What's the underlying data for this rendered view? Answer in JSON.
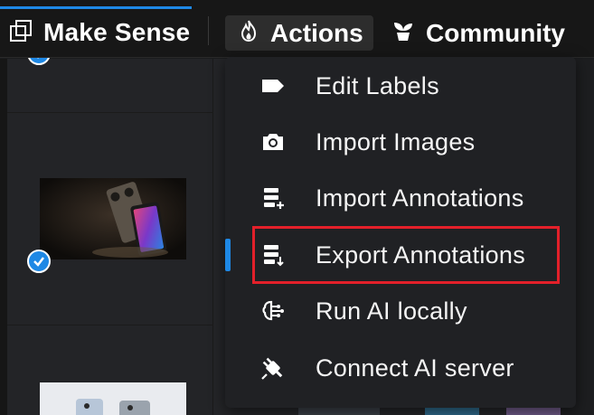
{
  "app": {
    "title": "Make Sense"
  },
  "nav": {
    "actions_label": "Actions",
    "community_label": "Community",
    "actions_icon": "flame-icon",
    "community_icon": "plant-icon",
    "brand_icon": "square-stack-icon"
  },
  "menu": {
    "items": [
      {
        "label": "Edit Labels",
        "icon": "tag-icon",
        "active": false
      },
      {
        "label": "Import Images",
        "icon": "camera-icon",
        "active": false
      },
      {
        "label": "Import Annotations",
        "icon": "list-add-icon",
        "active": false
      },
      {
        "label": "Export Annotations",
        "icon": "list-download-icon",
        "active": true
      },
      {
        "label": "Run AI locally",
        "icon": "brain-icon",
        "active": false
      },
      {
        "label": "Connect AI server",
        "icon": "plug-icon",
        "active": false
      }
    ]
  },
  "colors": {
    "accent": "#1e88e5",
    "highlight": "#e3202a",
    "menu_bg": "#202124",
    "topbar_bg": "#171717"
  }
}
